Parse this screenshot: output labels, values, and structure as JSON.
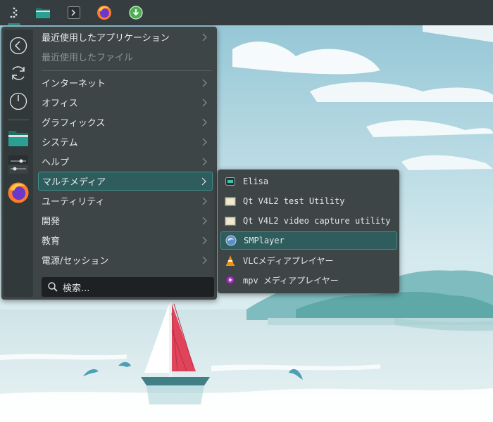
{
  "panel": {
    "launchers": [
      {
        "icon": "application-launcher-icon"
      },
      {
        "icon": "folder-icon"
      },
      {
        "icon": "terminal-icon"
      },
      {
        "icon": "firefox-icon"
      },
      {
        "icon": "download-icon"
      }
    ]
  },
  "menu": {
    "sidebar": [
      {
        "icon": "back-arrow-icon"
      },
      {
        "icon": "refresh-icon"
      },
      {
        "icon": "power-icon"
      },
      {
        "icon": "file-manager-icon"
      },
      {
        "icon": "system-settings-icon"
      },
      {
        "icon": "firefox-icon"
      }
    ],
    "recent_apps": "最近使用したアプリケーション",
    "recent_files": "最近使用したファイル",
    "categories": [
      {
        "label": "インターネット"
      },
      {
        "label": "オフィス"
      },
      {
        "label": "グラフィックス"
      },
      {
        "label": "システム"
      },
      {
        "label": "ヘルプ"
      },
      {
        "label": "マルチメディア",
        "selected": true
      },
      {
        "label": "ユーティリティ"
      },
      {
        "label": "開発"
      },
      {
        "label": "教育"
      },
      {
        "label": "電源/セッション"
      }
    ],
    "search_placeholder": "検索..."
  },
  "submenu": {
    "items": [
      {
        "label": "Elisa",
        "icon": "elisa-icon"
      },
      {
        "label": "Qt V4L2 test Utility",
        "icon": "qv4l2-icon"
      },
      {
        "label": "Qt V4L2 video capture utility",
        "icon": "qvidcap-icon"
      },
      {
        "label": "SMPlayer",
        "icon": "smplayer-icon",
        "selected": true
      },
      {
        "label": "VLCメディアプレイヤー",
        "icon": "vlc-cone-icon"
      },
      {
        "label": "mpv メディアプレイヤー",
        "icon": "mpv-icon"
      }
    ]
  },
  "colors": {
    "panel": "#363d40",
    "menu_bg": "#3e4547",
    "accent": "#3d8f89",
    "selection": "#2f5c5c"
  }
}
